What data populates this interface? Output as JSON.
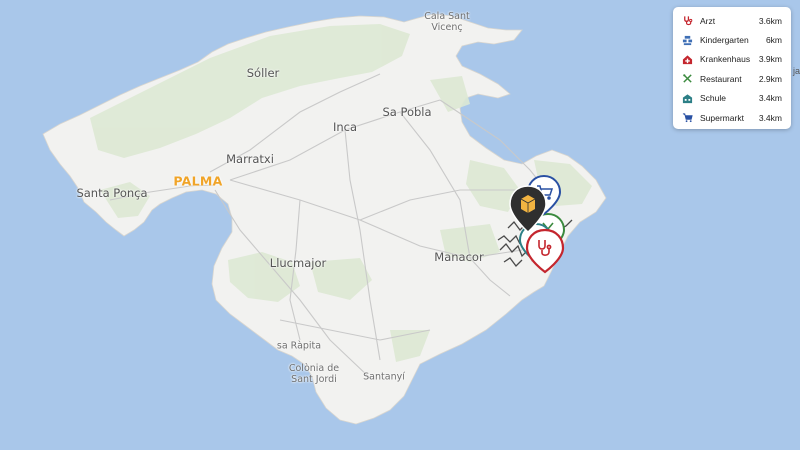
{
  "map": {
    "places": [
      {
        "id": "cala-sant-vicenc",
        "text": "Cala Sant Vicenç"
      },
      {
        "id": "soller",
        "text": "Sóller"
      },
      {
        "id": "sa-pobla",
        "text": "Sa Pobla"
      },
      {
        "id": "inca",
        "text": "Inca"
      },
      {
        "id": "marratxi",
        "text": "Marratxi"
      },
      {
        "id": "palma",
        "text": "PALMA"
      },
      {
        "id": "santa-ponca",
        "text": "Santa Ponça"
      },
      {
        "id": "llucmajor",
        "text": "Llucmajor"
      },
      {
        "id": "manacor",
        "text": "Manacor"
      },
      {
        "id": "sa-rapita",
        "text": "sa Ràpita"
      },
      {
        "id": "colonia-de-sant-jordi",
        "text": "Colònia de Sant Jordi"
      },
      {
        "id": "santanyi",
        "text": "Santanyí"
      }
    ],
    "edge_text": "ja",
    "colors": {
      "sea": "#a9c7ea",
      "land": "#f2f2f0",
      "vegetation": "#dde9d4",
      "road": "#c9c9c9",
      "capital": "#f0a428"
    }
  },
  "legend": {
    "items": [
      {
        "icon": "stethoscope-icon",
        "label": "Arzt",
        "distance": "3.6km",
        "color": "#c4262e"
      },
      {
        "icon": "kindergarten-icon",
        "label": "Kindergarten",
        "distance": "6km",
        "color": "#3f6fb5"
      },
      {
        "icon": "hospital-icon",
        "label": "Krankenhaus",
        "distance": "3.9km",
        "color": "#c4262e"
      },
      {
        "icon": "restaurant-icon",
        "label": "Restaurant",
        "distance": "2.9km",
        "color": "#3b8a3e"
      },
      {
        "icon": "school-icon",
        "label": "Schule",
        "distance": "3.4km",
        "color": "#2c7f86"
      },
      {
        "icon": "shopping-cart-icon",
        "label": "Supermarkt",
        "distance": "3.4km",
        "color": "#2950a3"
      }
    ]
  },
  "markers": [
    {
      "icon": "property-location-icon",
      "color": "#3a3a3a"
    },
    {
      "icon": "shopping-cart-icon",
      "color": "#2950a3"
    },
    {
      "icon": "restaurant-icon",
      "color": "#3b8a3e"
    },
    {
      "icon": "school-icon",
      "color": "#2c7f86"
    },
    {
      "icon": "stethoscope-icon",
      "color": "#c4262e"
    }
  ]
}
